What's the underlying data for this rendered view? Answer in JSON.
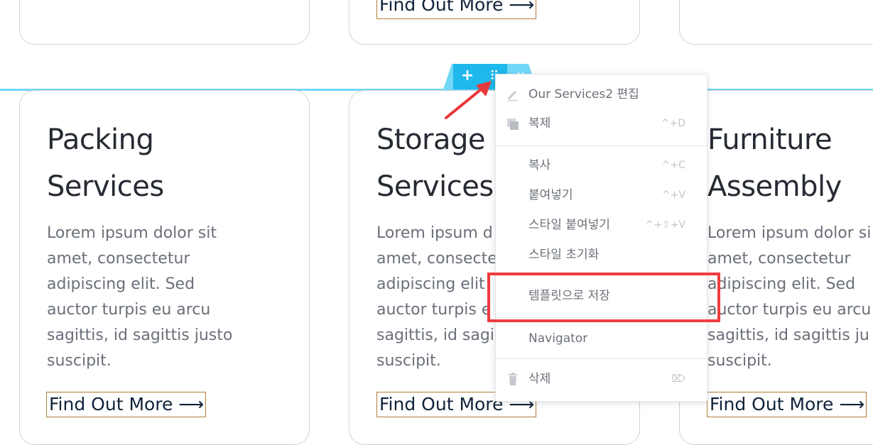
{
  "cards_top_row": [
    {
      "link": "Find Out More ⟶"
    }
  ],
  "cards": [
    {
      "title_line1": "Packing",
      "title_line2": "Services",
      "body": [
        "Lorem ipsum dolor sit",
        "amet, consectetur",
        "adipiscing elit. Sed",
        "auctor turpis eu arcu",
        "sagittis, id sagittis justo",
        "suscipit."
      ],
      "link": "Find Out More ⟶"
    },
    {
      "title_line1": "Storage",
      "title_line2": "Services",
      "body": [
        "Lorem ipsum d",
        "amet, consecte",
        "adipiscing elit",
        "auctor turpis e",
        "sagittis, id sagi",
        "suscipit."
      ],
      "link": "Find Out More ⟶"
    },
    {
      "title_line1": "Furniture",
      "title_line2": "Assembly",
      "body": [
        "Lorem ipsum dolor si",
        "amet, consectetur",
        "adipiscing elit. Sed",
        "auctor turpis eu arcu",
        "sagittis, id sagittis ju",
        "suscipit."
      ],
      "link": "Find Out More ⟶"
    }
  ],
  "section_handle": {
    "add_label": "+",
    "move_label": "⠿",
    "close_label": "✕"
  },
  "context_menu": {
    "items": [
      {
        "label": "Our Services2 편집",
        "shortcut": "",
        "icon": "pencil-icon"
      },
      {
        "label": "복제",
        "shortcut": "^+D",
        "icon": "duplicate-icon"
      },
      {
        "label": "복사",
        "shortcut": "^+C",
        "icon": ""
      },
      {
        "label": "붙여넣기",
        "shortcut": "^+V",
        "icon": ""
      },
      {
        "label": "스타일 붙여넣기",
        "shortcut": "^+⇧+V",
        "icon": ""
      },
      {
        "label": "스타일 초기화",
        "shortcut": "",
        "icon": ""
      },
      {
        "label": "템플릿으로 저장",
        "shortcut": "",
        "icon": ""
      },
      {
        "label": "Navigator",
        "shortcut": "",
        "icon": ""
      },
      {
        "label": "삭제",
        "shortcut": "⌦",
        "icon": "trash-icon"
      }
    ]
  },
  "colors": {
    "accent": "#71d7f7",
    "handle": "#1fb8ec",
    "highlight": "#f03b3f",
    "link_border": "#b07e3a"
  }
}
